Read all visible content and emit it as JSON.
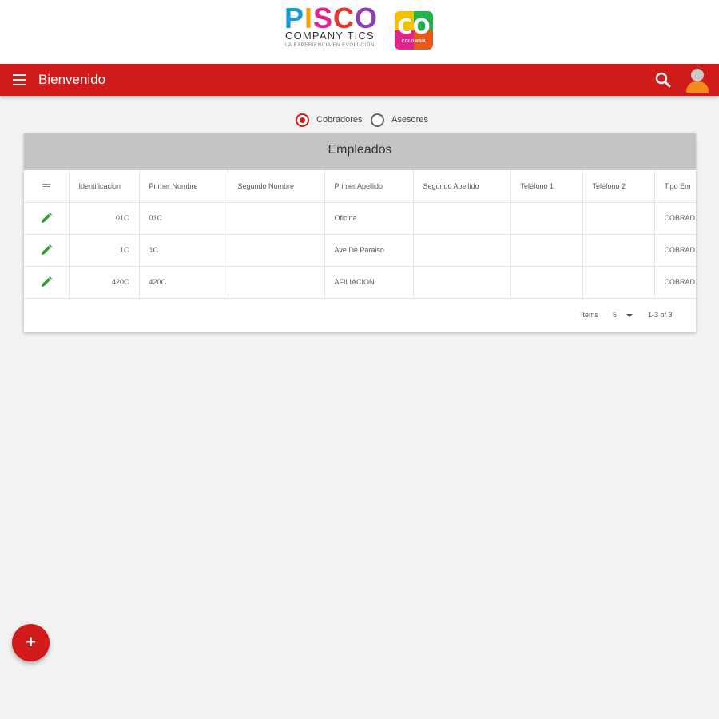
{
  "brand": {
    "logo_letters": [
      "P",
      "I",
      "S",
      "C",
      "O"
    ],
    "logo_colors": [
      "#1a9ad6",
      "#f2a900",
      "#e0248f",
      "#e03a2f",
      "#8e3fb5"
    ],
    "logo_subtitle": "COMPANY TICS",
    "logo_tagline": "LA EXPERIENCIA EN EVOLUCIÓN",
    "badge_text": "CO",
    "badge_subtext": "COLOMBIA"
  },
  "topbar": {
    "title": "Bienvenido",
    "menu_icon": "hamburger-menu-icon",
    "search_icon": "search-icon",
    "avatar_icon": "user-avatar-icon",
    "color": "#d11b1b"
  },
  "filter": {
    "options": [
      {
        "label": "Cobradores",
        "checked": true
      },
      {
        "label": "Asesores",
        "checked": false
      }
    ]
  },
  "table": {
    "title": "Empleados",
    "columns": [
      "Identificacion",
      "Primer Nombre",
      "Segundo Nombre",
      "Primer Apellido",
      "Segundo Apellido",
      "Teléfono 1",
      "Teléfono 2",
      "Tipo Em"
    ],
    "rows": [
      [
        "01C",
        "01C",
        "",
        "Oficina",
        "",
        "",
        "",
        "COBRAD"
      ],
      [
        "1C",
        "1C",
        "",
        "Ave De Paraiso",
        "",
        "",
        "",
        "COBRAD"
      ],
      [
        "420C",
        "420C",
        "",
        "AFILIACION",
        "",
        "",
        "",
        "COBRAD"
      ]
    ],
    "row_action_icon": "edit-pencil-icon",
    "action_color": "#2e9e2e"
  },
  "pagination": {
    "items_label": "Items",
    "page_size": "5",
    "range": "1-3 of 3"
  },
  "fab": {
    "label": "+",
    "icon": "add-icon"
  }
}
